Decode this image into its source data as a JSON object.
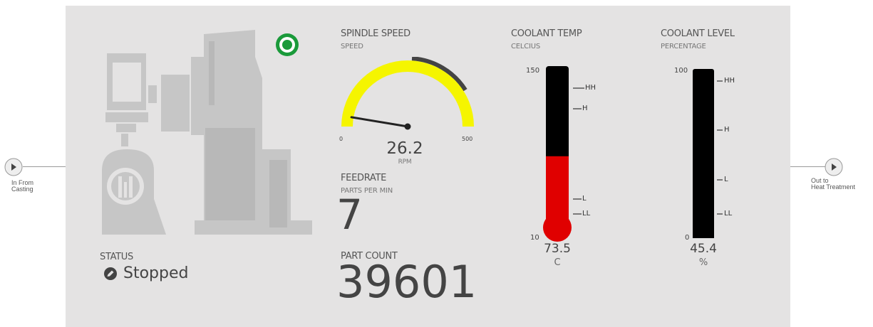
{
  "left_connector": {
    "label_line1": "In From",
    "label_line2": "Casting",
    "icon": "play-circle-icon"
  },
  "right_connector": {
    "label_line1": "Out to",
    "label_line2": "Heat Treatment",
    "icon": "play-circle-icon"
  },
  "machine": {
    "icon": "milling-machine-icon",
    "indicator": "running-indicator-icon",
    "indicator_color": "#1a9a3a"
  },
  "status": {
    "label": "STATUS",
    "value": "Stopped",
    "icon": "stopped-icon"
  },
  "spindle": {
    "title": "SPINDLE SPEED",
    "subtitle": "SPEED",
    "min_label": "0",
    "max_label": "500",
    "value_text": "26.2",
    "unit": "RPM",
    "value": 26.2,
    "min": 0,
    "max": 500,
    "high_band_from": 425,
    "high_band_to": 500,
    "arc_color": "#f5f500",
    "band_color": "#444444"
  },
  "feedrate": {
    "title": "FEEDRATE",
    "subtitle": "PARTS PER MIN",
    "value": "7"
  },
  "part_count": {
    "title": "PART COUNT",
    "value": "39601"
  },
  "coolant_temp": {
    "title": "COOLANT TEMP",
    "subtitle": "CELCIUS",
    "max_label": "150",
    "min_label": "10",
    "value_text": "73.5",
    "unit": "C",
    "value": 73.5,
    "min": 10,
    "max": 150,
    "fill_color": "#e00000",
    "marks": [
      "HH",
      "H",
      "L",
      "LL"
    ]
  },
  "coolant_level": {
    "title": "COOLANT LEVEL",
    "subtitle": "PERCENTAGE",
    "max_label": "100",
    "min_label": "0",
    "value_text": "45.4",
    "unit": "%",
    "value": 45.4,
    "min": 0,
    "max": 100,
    "marks": [
      "HH",
      "H",
      "L",
      "LL"
    ]
  }
}
